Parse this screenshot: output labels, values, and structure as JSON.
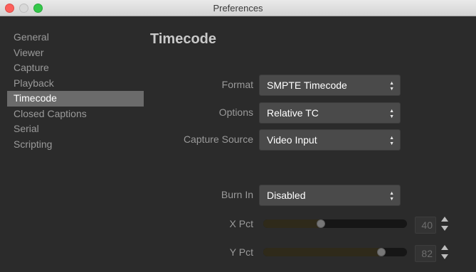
{
  "window": {
    "title": "Preferences"
  },
  "sidebar": {
    "items": [
      {
        "label": "General"
      },
      {
        "label": "Viewer"
      },
      {
        "label": "Capture"
      },
      {
        "label": "Playback"
      },
      {
        "label": "Timecode",
        "selected": true
      },
      {
        "label": "Closed Captions"
      },
      {
        "label": "Serial"
      },
      {
        "label": "Scripting"
      }
    ]
  },
  "main": {
    "title": "Timecode",
    "format": {
      "label": "Format",
      "value": "SMPTE Timecode"
    },
    "options": {
      "label": "Options",
      "value": "Relative TC"
    },
    "capture_source": {
      "label": "Capture Source",
      "value": "Video Input"
    },
    "burn_in": {
      "label": "Burn In",
      "value": "Disabled"
    },
    "x_pct": {
      "label": "X Pct",
      "value": "40",
      "level": 0.4
    },
    "y_pct": {
      "label": "Y Pct",
      "value": "82",
      "level": 0.82
    }
  },
  "icons": {
    "select_arrows": "up-down-chevron-icon",
    "stepper": "stepper-icon"
  },
  "colors": {
    "background": "#2b2b2b",
    "sidebar_selected": "#6b6b6b",
    "select_bg": "#4a4a4a"
  }
}
